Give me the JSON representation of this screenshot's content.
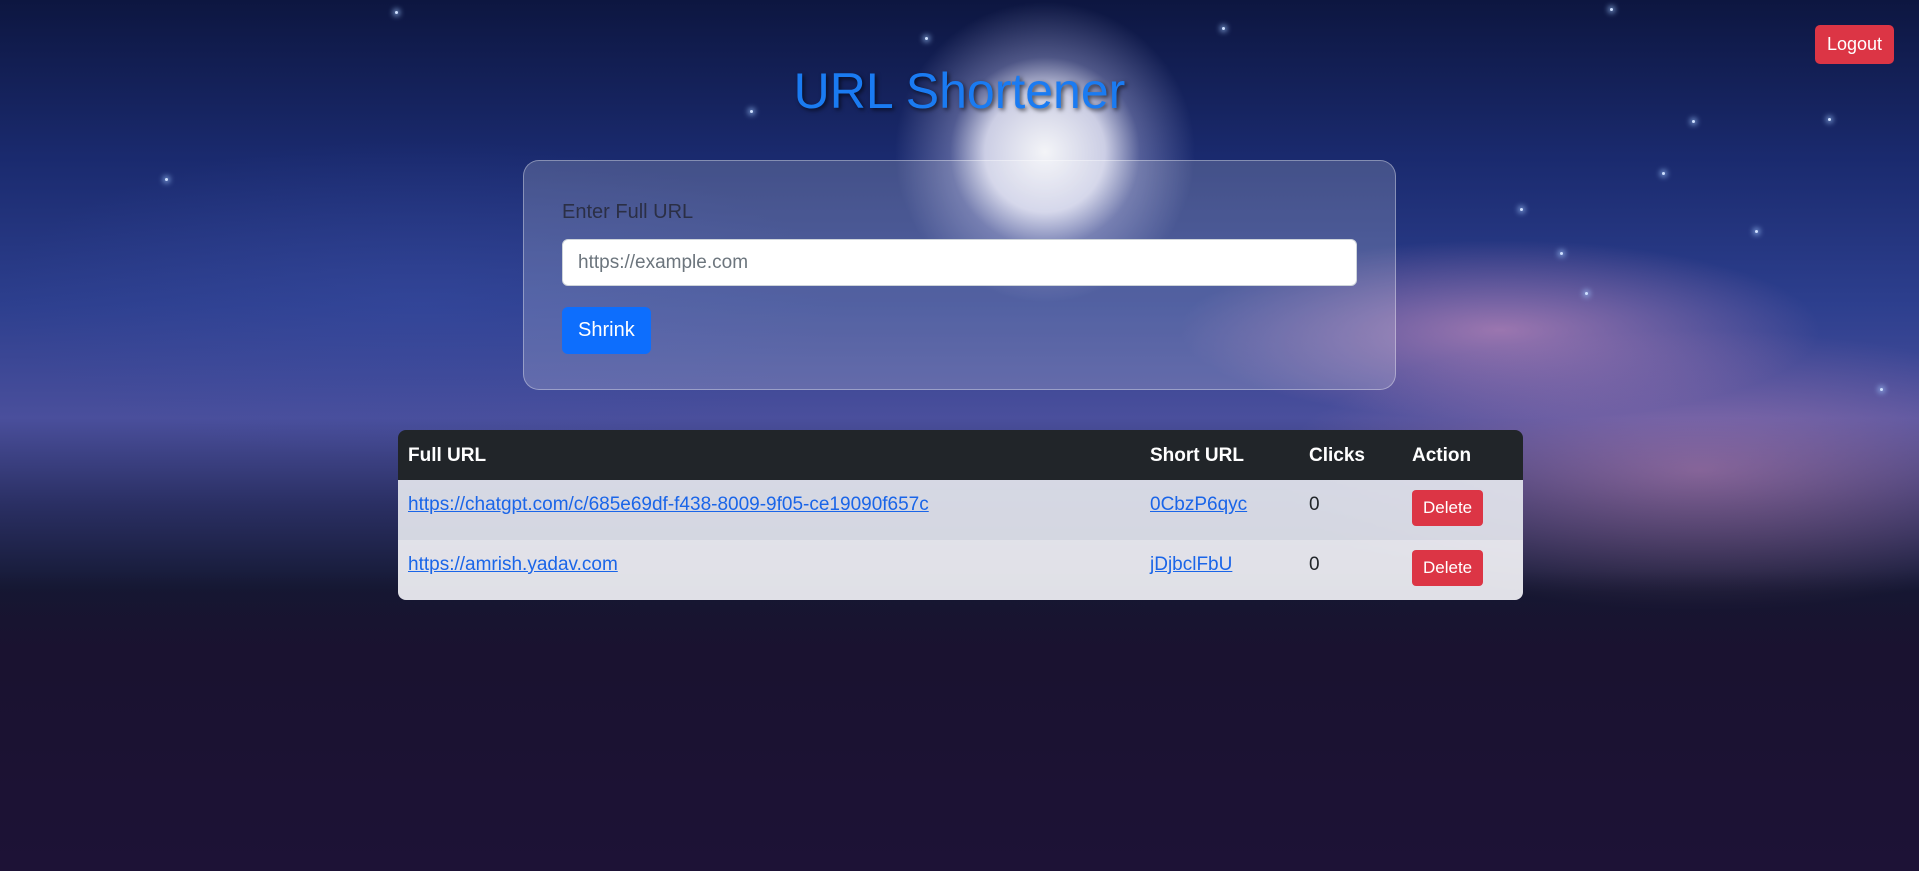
{
  "header": {
    "title": "URL Shortener",
    "logout_label": "Logout"
  },
  "form": {
    "label": "Enter Full URL",
    "input_value": "",
    "input_placeholder": "https://example.com",
    "submit_label": "Shrink"
  },
  "table": {
    "columns": [
      "Full URL",
      "Short URL",
      "Clicks",
      "Action"
    ],
    "rows": [
      {
        "full_url": "https://chatgpt.com/c/685e69df-f438-8009-9f05-ce19090f657c",
        "short_url": "0CbzP6qyc",
        "clicks": "0",
        "action_label": "Delete"
      },
      {
        "full_url": "https://amrish.yadav.com",
        "short_url": "jDjbclFbU",
        "clicks": "0",
        "action_label": "Delete"
      }
    ]
  },
  "colors": {
    "primary": "#0d6efd",
    "danger": "#dc3545",
    "table_header": "#212529",
    "title": "#1a7bf2"
  }
}
